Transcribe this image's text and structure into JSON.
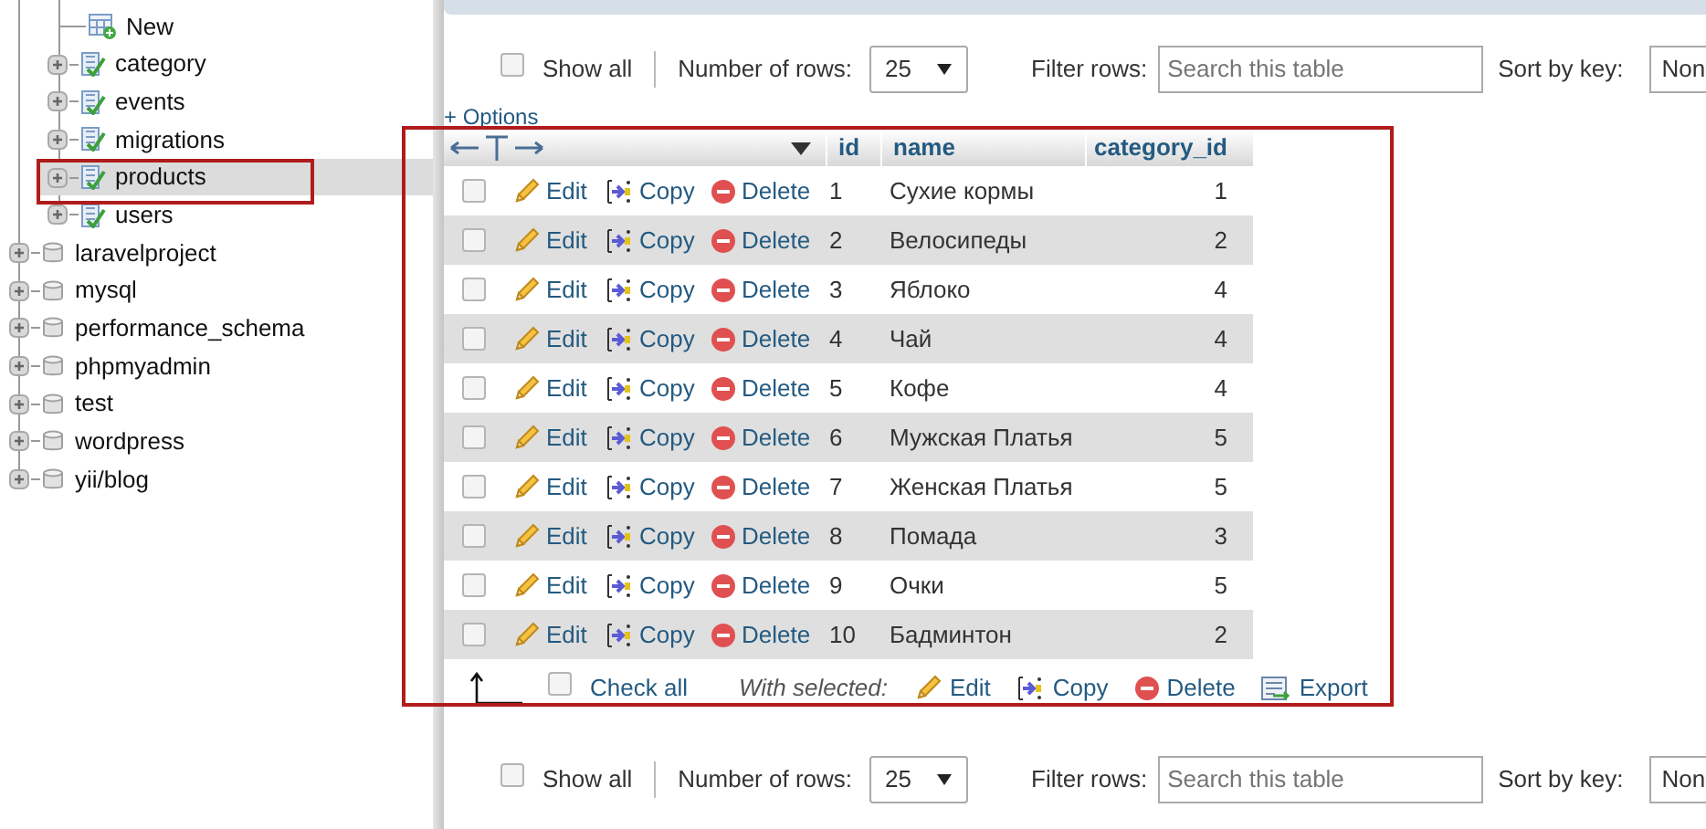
{
  "sidebar": {
    "tables": [
      {
        "kind": "new",
        "label": "New",
        "selected": false
      },
      {
        "kind": "table",
        "label": "category",
        "selected": false
      },
      {
        "kind": "table",
        "label": "events",
        "selected": false
      },
      {
        "kind": "table",
        "label": "migrations",
        "selected": false
      },
      {
        "kind": "table",
        "label": "products",
        "selected": true
      },
      {
        "kind": "table",
        "label": "users",
        "selected": false
      }
    ],
    "databases": [
      {
        "label": "laravelproject"
      },
      {
        "label": "mysql"
      },
      {
        "label": "performance_schema"
      },
      {
        "label": "phpmyadmin"
      },
      {
        "label": "test"
      },
      {
        "label": "wordpress"
      },
      {
        "label": "yii/blog"
      }
    ]
  },
  "toolbar": {
    "show_all": {
      "label": "Show all",
      "checked": false
    },
    "rows_label": "Number of rows:",
    "rows_value": "25",
    "filter_label": "Filter rows:",
    "filter_placeholder": "Search this table",
    "sort_label": "Sort by key:",
    "sort_value": "Non"
  },
  "table": {
    "options_link": "+ Options",
    "columns": [
      "id",
      "name",
      "category_id"
    ],
    "rows": [
      {
        "checked": false,
        "actions": [
          "Edit",
          "Copy",
          "Delete"
        ],
        "id": "1",
        "name": "Сухие кормы",
        "category_id": "1"
      },
      {
        "checked": false,
        "actions": [
          "Edit",
          "Copy",
          "Delete"
        ],
        "id": "2",
        "name": "Велосипеды",
        "category_id": "2"
      },
      {
        "checked": false,
        "actions": [
          "Edit",
          "Copy",
          "Delete"
        ],
        "id": "3",
        "name": "Яблоко",
        "category_id": "4"
      },
      {
        "checked": false,
        "actions": [
          "Edit",
          "Copy",
          "Delete"
        ],
        "id": "4",
        "name": "Чай",
        "category_id": "4"
      },
      {
        "checked": false,
        "actions": [
          "Edit",
          "Copy",
          "Delete"
        ],
        "id": "5",
        "name": "Кофе",
        "category_id": "4"
      },
      {
        "checked": false,
        "actions": [
          "Edit",
          "Copy",
          "Delete"
        ],
        "id": "6",
        "name": "Мужская Платья",
        "category_id": "5"
      },
      {
        "checked": false,
        "actions": [
          "Edit",
          "Copy",
          "Delete"
        ],
        "id": "7",
        "name": "Женская Платья",
        "category_id": "5"
      },
      {
        "checked": false,
        "actions": [
          "Edit",
          "Copy",
          "Delete"
        ],
        "id": "8",
        "name": "Помада",
        "category_id": "3"
      },
      {
        "checked": false,
        "actions": [
          "Edit",
          "Copy",
          "Delete"
        ],
        "id": "9",
        "name": "Очки",
        "category_id": "5"
      },
      {
        "checked": false,
        "actions": [
          "Edit",
          "Copy",
          "Delete"
        ],
        "id": "10",
        "name": "Бадминтон",
        "category_id": "2"
      }
    ]
  },
  "footer": {
    "check_all": {
      "label": "Check all",
      "checked": false
    },
    "with_selected": "With selected:",
    "actions": [
      {
        "kind": "edit",
        "label": "Edit"
      },
      {
        "kind": "copy",
        "label": "Copy"
      },
      {
        "kind": "delete",
        "label": "Delete"
      },
      {
        "kind": "export",
        "label": "Export"
      }
    ]
  },
  "toolbar_bottom": {
    "show_all": {
      "label": "Show all",
      "checked": false
    },
    "rows_label": "Number of rows:",
    "rows_value": "25",
    "filter_label": "Filter rows:",
    "filter_placeholder": "Search this table",
    "sort_label": "Sort by key:",
    "sort_value": "Non"
  }
}
